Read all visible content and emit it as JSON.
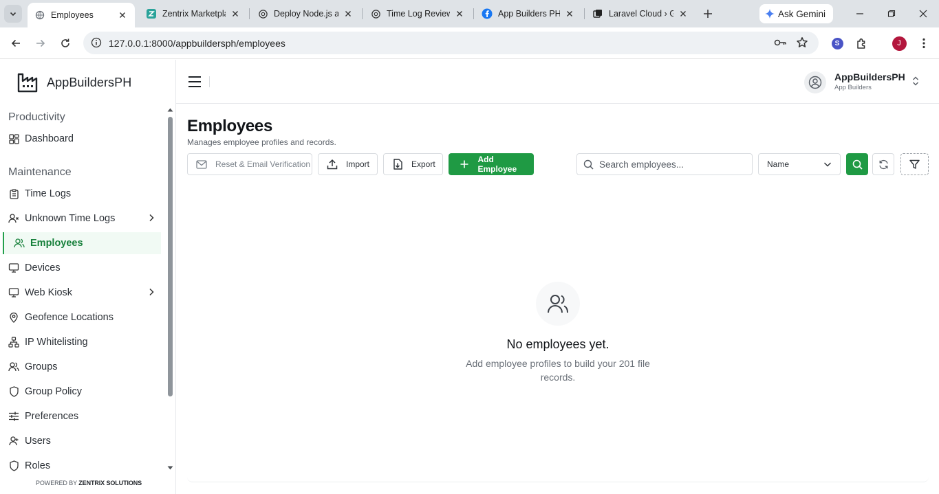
{
  "browser": {
    "tabs": [
      {
        "title": "Employees",
        "active": true
      },
      {
        "title": "Zentrix Marketpla",
        "active": false
      },
      {
        "title": "Deploy Node.js a",
        "active": false
      },
      {
        "title": "Time Log Review",
        "active": false
      },
      {
        "title": "App Builders PH |",
        "active": false
      },
      {
        "title": "Laravel Cloud › G",
        "active": false
      }
    ],
    "gemini_label": "Ask Gemini",
    "url": "127.0.0.1:8000/appbuildersph/employees",
    "extension_avatar": "S",
    "profile_avatar": "J",
    "colors": {
      "profile": "#b3173d",
      "extension": "#4a54c6"
    }
  },
  "sidebar": {
    "brand": "AppBuildersPH",
    "sections": [
      {
        "title": "Productivity"
      },
      {
        "title": "Maintenance"
      }
    ],
    "items": [
      {
        "label": "Dashboard",
        "icon": "grid-icon"
      },
      {
        "label": "Time Logs",
        "icon": "clipboard-icon"
      },
      {
        "label": "Unknown Time Logs",
        "icon": "user-x-icon",
        "has_children": true
      },
      {
        "label": "Employees",
        "icon": "users-icon",
        "active": true
      },
      {
        "label": "Devices",
        "icon": "monitor-icon"
      },
      {
        "label": "Web Kiosk",
        "icon": "monitor-icon",
        "has_children": true
      },
      {
        "label": "Geofence Locations",
        "icon": "map-pin-icon"
      },
      {
        "label": "IP Whitelisting",
        "icon": "network-icon"
      },
      {
        "label": "Groups",
        "icon": "users-icon"
      },
      {
        "label": "Group Policy",
        "icon": "shield-icon"
      },
      {
        "label": "Preferences",
        "icon": "sliders-icon"
      },
      {
        "label": "Users",
        "icon": "user-icon"
      },
      {
        "label": "Roles",
        "icon": "shield-icon"
      }
    ],
    "powered_prefix": "POWERED BY",
    "powered_brand": "ZENTRIX SOLUTIONS"
  },
  "header": {
    "org_name": "AppBuildersPH",
    "org_sub": "App Builders"
  },
  "main": {
    "title": "Employees",
    "subtitle": "Manages employee profiles and records.",
    "buttons": {
      "reset": "Reset & Email Verification",
      "import": "Import",
      "export": "Export",
      "add": "Add Employee"
    },
    "search_placeholder": "Search employees...",
    "sort_value": "Name",
    "empty": {
      "title": "No employees yet.",
      "description": "Add employee profiles to build your 201 file records."
    },
    "colors": {
      "primary": "#1f9a44",
      "active_bg": "#f1faf4",
      "active_text": "#17803b"
    }
  }
}
